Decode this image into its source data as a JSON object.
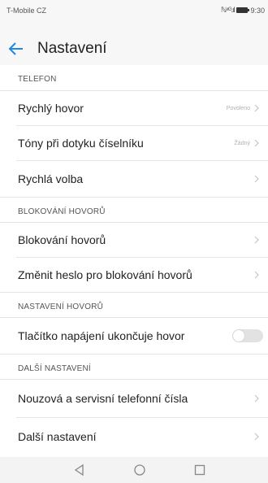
{
  "status_bar": {
    "carrier": "T-Mobile CZ",
    "signal": "ℕ⁴ᴳ.ıl",
    "time": "9:30"
  },
  "header": {
    "title": "Nastavení",
    "back_icon": "back-arrow-icon"
  },
  "sections": {
    "telefon": "TELEFON",
    "blokovani": "BLOKOVÁNÍ HOVORŮ",
    "nastaveni_hovoru": "NASTAVENÍ HOVORŮ",
    "dalsi": "DALŠÍ NASTAVENÍ"
  },
  "rows": {
    "rychly_hovor": {
      "label": "Rychlý hovor",
      "value": "Povoleno"
    },
    "tony": {
      "label": "Tóny při dotyku číselníku",
      "value": "Žádný"
    },
    "rychla_volba": {
      "label": "Rychlá volba"
    },
    "blokovani": {
      "label": "Blokování hovorů"
    },
    "zmenit_heslo": {
      "label": "Změnit heslo pro blokování hovorů"
    },
    "tlacitko": {
      "label": "Tlačítko napájení ukončuje hovor",
      "toggle_on": false
    },
    "nouzova": {
      "label": "Nouzová a servisní telefonní čísla"
    },
    "dalsi_nastaveni": {
      "label": "Další nastavení"
    }
  },
  "colors": {
    "accent": "#1e88e5",
    "text": "#222222",
    "secondary_text": "#555555",
    "chevron": "#c4c4c4",
    "toggle_off": "#e2e2e2"
  },
  "navbar": {
    "icons": [
      "back-triangle-icon",
      "home-circle-icon",
      "recents-square-icon"
    ]
  }
}
